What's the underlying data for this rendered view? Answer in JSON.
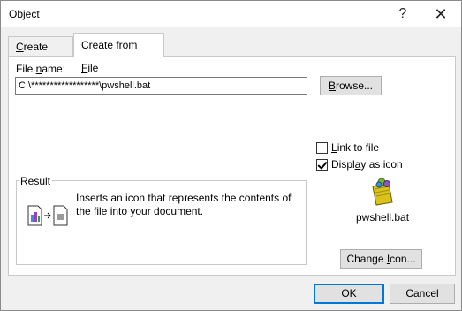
{
  "window": {
    "title": "Object",
    "help_glyph": "?",
    "close_glyph": "✕"
  },
  "tabs": [
    {
      "label_pre": "",
      "label_key": "C",
      "label_post": "reate New",
      "active": false
    },
    {
      "label_pre": "Create from ",
      "label_key": "F",
      "label_post": "ile",
      "active": true
    }
  ],
  "file_name": {
    "label_pre": "File ",
    "label_key": "n",
    "label_post": "ame:",
    "value": "C:\\******************\\pwshell.bat"
  },
  "browse_button": {
    "key": "B",
    "rest": "rowse..."
  },
  "options": [
    {
      "pre": "",
      "key": "L",
      "post": "ink to file",
      "checked": false
    },
    {
      "pre": "Displ",
      "key": "a",
      "post": "y as icon",
      "checked": true
    }
  ],
  "result": {
    "title": "Result",
    "text": "Inserts an icon that represents the contents of the file into your document."
  },
  "icon_preview": {
    "icon": "batch-file-icon",
    "caption": "pwshell.bat"
  },
  "change_icon_button": {
    "pre": "Change ",
    "key": "I",
    "post": "con..."
  },
  "ok_button": "OK",
  "cancel_button": "Cancel",
  "colors": {
    "dialog_bg": "#f0f0f0",
    "panel_bg": "#ffffff",
    "focus_border": "#0078d7"
  }
}
